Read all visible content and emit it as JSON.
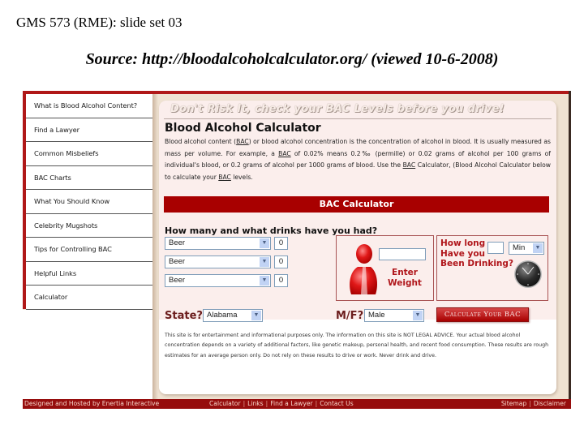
{
  "slide": {
    "header": "GMS 573 (RME): slide set 03",
    "source": "Source: http://bloodalcoholcalculator.org/ (viewed 10-6-2008)"
  },
  "sidebar": {
    "items": [
      {
        "label": "What is Blood Alcohol Content?"
      },
      {
        "label": "Find a Lawyer"
      },
      {
        "label": "Common Misbeliefs"
      },
      {
        "label": "BAC Charts"
      },
      {
        "label": "What You Should Know"
      },
      {
        "label": "Celebrity Mugshots"
      },
      {
        "label": "Tips for Controlling BAC"
      },
      {
        "label": "Helpful Links"
      },
      {
        "label": "Calculator"
      }
    ]
  },
  "main": {
    "tagline": "Don't Risk It, check your BAC Levels before you drive!",
    "title": "Blood Alcohol Calculator",
    "intro": {
      "p1": "Blood alcohol content (",
      "bac": "BAC",
      "p2": ") or blood alcohol concentration is the concentration of alcohol in blood. It is usually measured as mass per volume. For example, a ",
      "p3": " of 0.02% means 0.2‰ (permille) or 0.02 grams of alcohol per 100 grams of individual's blood, or 0.2 grams of alcohol per 1000 grams of blood. Use the ",
      "p4": " Calculator, (Blood Alcohol Calculator below to calculate your ",
      "p5": " levels."
    },
    "calculator": {
      "heading": "BAC Calculator",
      "drinks_question": "How many and what drinks have you had?",
      "drinks": [
        {
          "type": "Beer",
          "qty": "0"
        },
        {
          "type": "Beer",
          "qty": "0"
        },
        {
          "type": "Beer",
          "qty": "0"
        }
      ],
      "weight": {
        "label_line1": "Enter",
        "label_line2": "Weight",
        "value": ""
      },
      "duration": {
        "label_line1": "How long",
        "label_line2": "Have you",
        "label_line3": "Been Drinking?",
        "value": "",
        "unit": "Min"
      },
      "state_label": "State?",
      "state_value": "Alabama",
      "sex_label": "M/F?",
      "sex_value": "Male",
      "calculate_button": "Calculate Your BAC"
    },
    "disclaimer": "This site is for entertainment and informational purposes only. The information on this site is NOT LEGAL ADVICE. Your actual blood alcohol concentration depends on a variety of additional factors, like genetic makeup, personal health, and recent food consumption. These results are rough estimates for an average person only. Do not rely on these results to drive or work. Never drink and drive."
  },
  "footer": {
    "credit": "Designed and Hosted by Enertia Interactive",
    "links": [
      "Calculator",
      "Links",
      "Find a Lawyer",
      "Contact Us"
    ],
    "right_links": [
      "Sitemap",
      "Disclaimer"
    ]
  },
  "colors": {
    "brand_red": "#a80000",
    "accent_red": "#b0161b",
    "background_tan": "#efe2d2",
    "panel_pink": "#fbeeec"
  }
}
